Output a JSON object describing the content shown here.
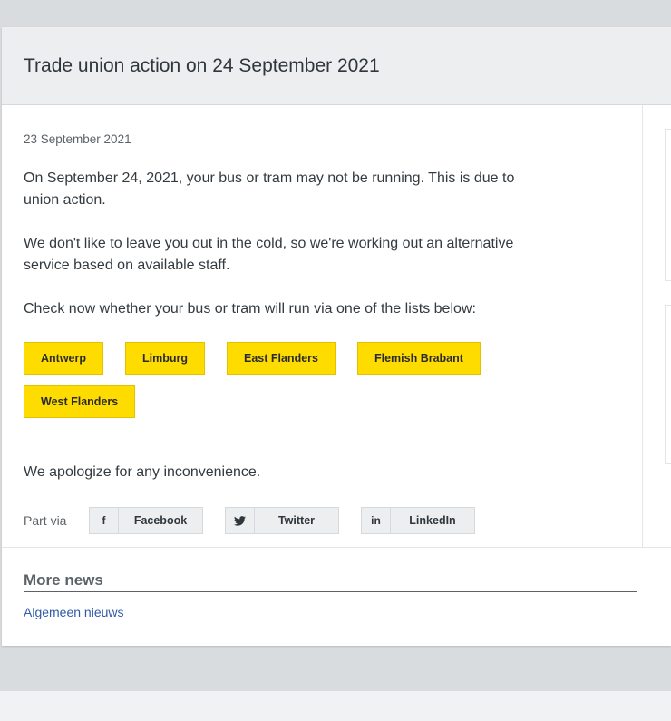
{
  "article": {
    "title": "Trade union action on 24 September 2021",
    "date": "23 September 2021",
    "paragraphs": [
      "On September 24, 2021, your bus or tram may not be running. This is due to union action.",
      "We don't like to leave you out in the cold, so we're working out an alternative service based on available staff.",
      "Check now whether your bus or tram will run via one of the lists below:"
    ],
    "regions": [
      "Antwerp",
      "Limburg",
      "East Flanders",
      "Flemish Brabant",
      "West Flanders"
    ],
    "apology": "We apologize for any inconvenience."
  },
  "share": {
    "label": "Part via",
    "buttons": [
      {
        "icon": "facebook-icon",
        "glyph": "f",
        "label": "Facebook"
      },
      {
        "icon": "twitter-icon",
        "glyph": "🐦",
        "label": "Twitter"
      },
      {
        "icon": "linkedin-icon",
        "glyph": "in",
        "label": "LinkedIn"
      }
    ]
  },
  "more_news": {
    "title": "More news",
    "link": "Algemeen nieuws"
  },
  "colors": {
    "accent_yellow": "#ffdc00",
    "link_blue": "#2f5aa8",
    "page_bg": "#d9dcdf"
  }
}
